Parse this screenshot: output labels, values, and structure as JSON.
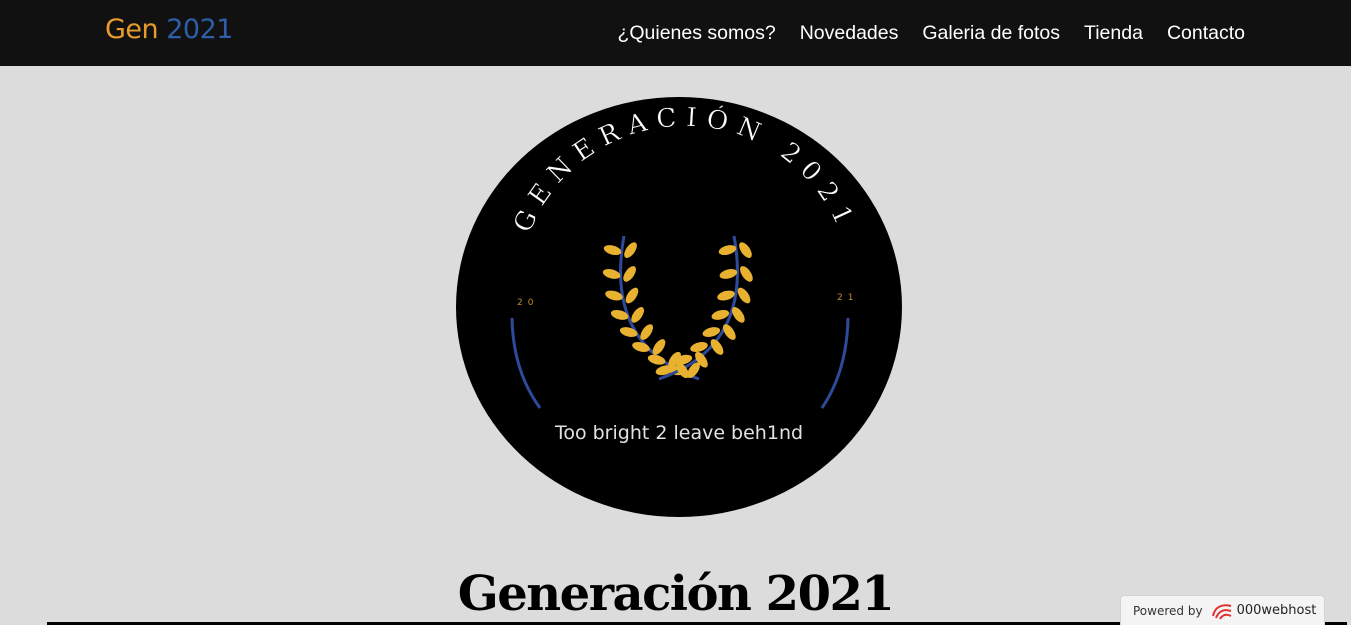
{
  "nav": {
    "brand_part1": "Gen",
    "brand_part2": "2021",
    "links": [
      {
        "label": "¿Quienes somos?"
      },
      {
        "label": "Novedades"
      },
      {
        "label": "Galeria de fotos"
      },
      {
        "label": "Tienda"
      },
      {
        "label": "Contacto"
      }
    ]
  },
  "logo": {
    "arc_text": "GENERACIÓN 2021",
    "left_year": "20",
    "right_year": "21",
    "tagline": "Too bright 2 leave beh1nd"
  },
  "main": {
    "heading": "Generación 2021"
  },
  "footer_badge": {
    "label": "Powered by",
    "brand": "000webhost"
  },
  "colors": {
    "nav_bg": "#111111",
    "page_bg": "#dcdcdc",
    "brand_orange": "#e89a2c",
    "brand_blue": "#2f5ea8",
    "laurel_gold": "#e8b230",
    "laurel_stem": "#2e4a9a"
  }
}
